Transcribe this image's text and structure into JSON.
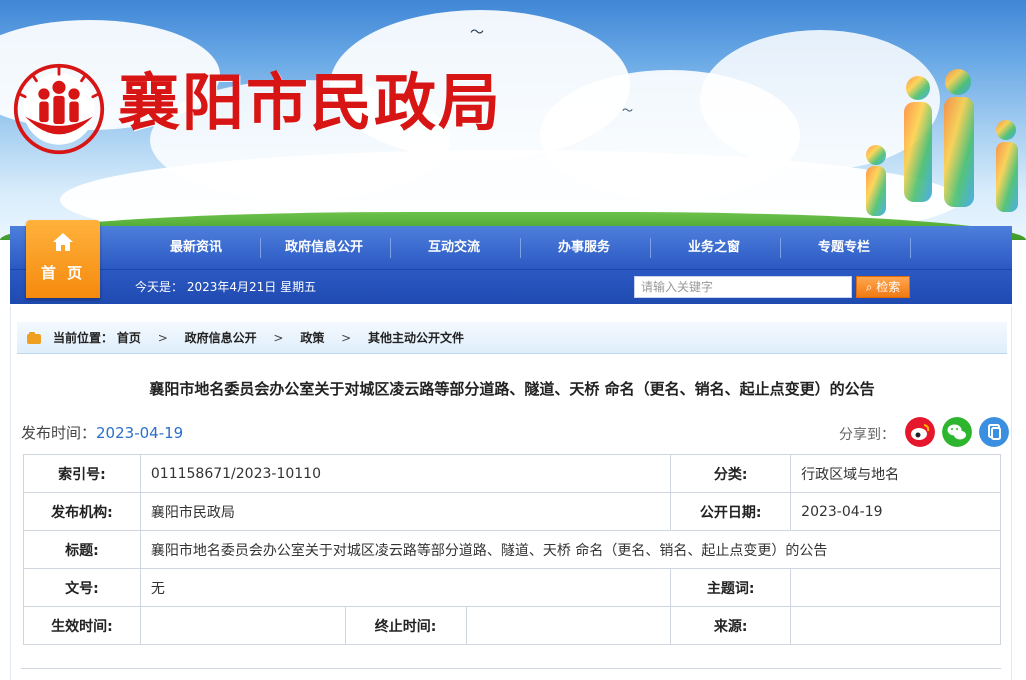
{
  "site": {
    "title": "襄阳市民政局",
    "home_label": "首 页"
  },
  "nav": {
    "items": [
      "最新资讯",
      "政府信息公开",
      "互动交流",
      "办事服务",
      "业务之窗",
      "专题专栏"
    ]
  },
  "subbar": {
    "date_text": "今天是：  2023年4月21日 星期五",
    "search_placeholder": "请输入关键字",
    "search_button": "检索"
  },
  "breadcrumb": {
    "label": "当前位置：",
    "items": [
      "首页",
      "政府信息公开",
      "政策",
      "其他主动公开文件"
    ]
  },
  "article": {
    "title": "襄阳市地名委员会办公室关于对城区凌云路等部分道路、隧道、天桥 命名（更名、销名、起止点变更）的公告",
    "publish_label": "发布时间：",
    "publish_date": "2023-04-19",
    "share_label": "分享到："
  },
  "share": [
    "weibo-icon",
    "wechat-icon",
    "copy-icon"
  ],
  "info_table": {
    "index_key": "索引号:",
    "index_val": "011158671/2023-10110",
    "category_key": "分类:",
    "category_val": "行政区域与地名",
    "org_key": "发布机构:",
    "org_val": "襄阳市民政局",
    "date_key": "公开日期:",
    "date_val": "2023-04-19",
    "title_key": "标题:",
    "title_val": "襄阳市地名委员会办公室关于对城区凌云路等部分道路、隧道、天桥 命名（更名、销名、起止点变更）的公告",
    "docno_key": "文号:",
    "docno_val": "无",
    "topic_key": "主题词:",
    "topic_val": "",
    "effective_key": "生效时间:",
    "effective_val": "",
    "end_key": "终止时间:",
    "end_val": "",
    "source_key": "来源:",
    "source_val": ""
  },
  "colors": {
    "nav": "#2b59c3",
    "brand": "#d81515",
    "accent": "#f58a0e",
    "link": "#2a6fc9"
  }
}
